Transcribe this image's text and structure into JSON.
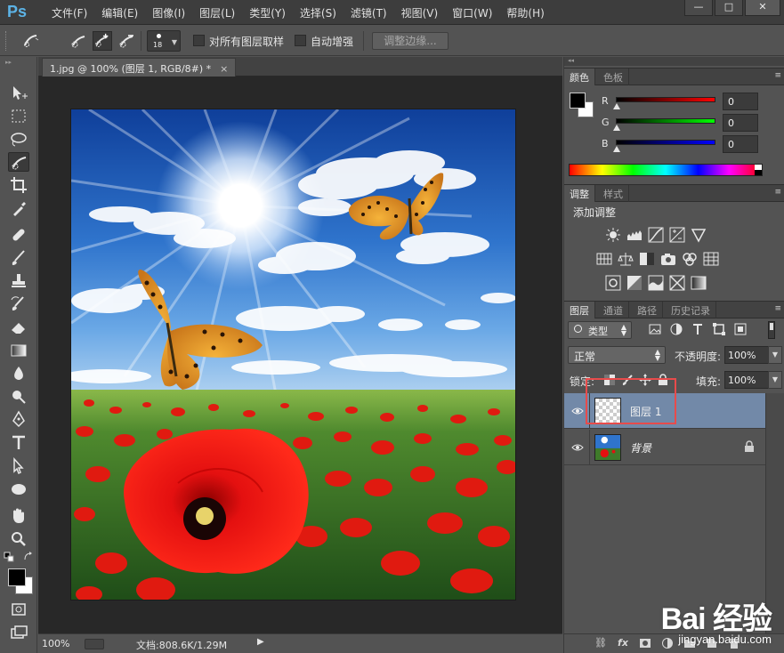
{
  "app": {
    "logo": "Ps"
  },
  "menu": [
    "文件(F)",
    "编辑(E)",
    "图像(I)",
    "图层(L)",
    "类型(Y)",
    "选择(S)",
    "滤镜(T)",
    "视图(V)",
    "窗口(W)",
    "帮助(H)"
  ],
  "window_controls": {
    "minimize": "—",
    "maximize": "□",
    "close": "✕"
  },
  "options": {
    "brush_size": "18",
    "sample_all_layers": "对所有图层取样",
    "auto_enhance": "自动增强",
    "refine_edge": "调整边缘..."
  },
  "document": {
    "tab_title": "1.jpg @ 100% (图层 1, RGB/8#) *",
    "tab_close": "×",
    "zoom": "100%",
    "doc_size": "文档:808.6K/1.29M"
  },
  "color_panel": {
    "tabs": [
      "颜色",
      "色板"
    ],
    "r_label": "R",
    "g_label": "G",
    "b_label": "B",
    "r_value": "0",
    "g_value": "0",
    "b_value": "0",
    "slider_colors": {
      "r": "#cc0000",
      "g": "#00c000",
      "b": "#0000cc"
    }
  },
  "adjust_panel": {
    "tabs": [
      "调整",
      "样式"
    ],
    "title": "添加调整"
  },
  "layers_panel": {
    "tabs": [
      "图层",
      "通道",
      "路径",
      "历史记录"
    ],
    "filter_kind": "类型",
    "blend_mode": "正常",
    "opacity_label": "不透明度:",
    "opacity_value": "100%",
    "lock_label": "锁定:",
    "fill_label": "填充:",
    "fill_value": "100%",
    "layers": [
      {
        "name": "图层 1",
        "selected": true
      },
      {
        "name": "背景",
        "selected": false,
        "locked": true
      }
    ],
    "bottom_icons": [
      "link-icon",
      "fx-icon",
      "mask-icon",
      "adjustment-icon",
      "group-icon",
      "new-layer-icon",
      "trash-icon"
    ],
    "fx_text": "fx"
  },
  "watermark": {
    "logo": "Bai 经验",
    "url": "jingyan.baidu.com"
  },
  "colors": {
    "accent_highlight": "#e84b4b",
    "selected_layer": "#7289a8",
    "ps_blue": "#5cb3e6"
  }
}
